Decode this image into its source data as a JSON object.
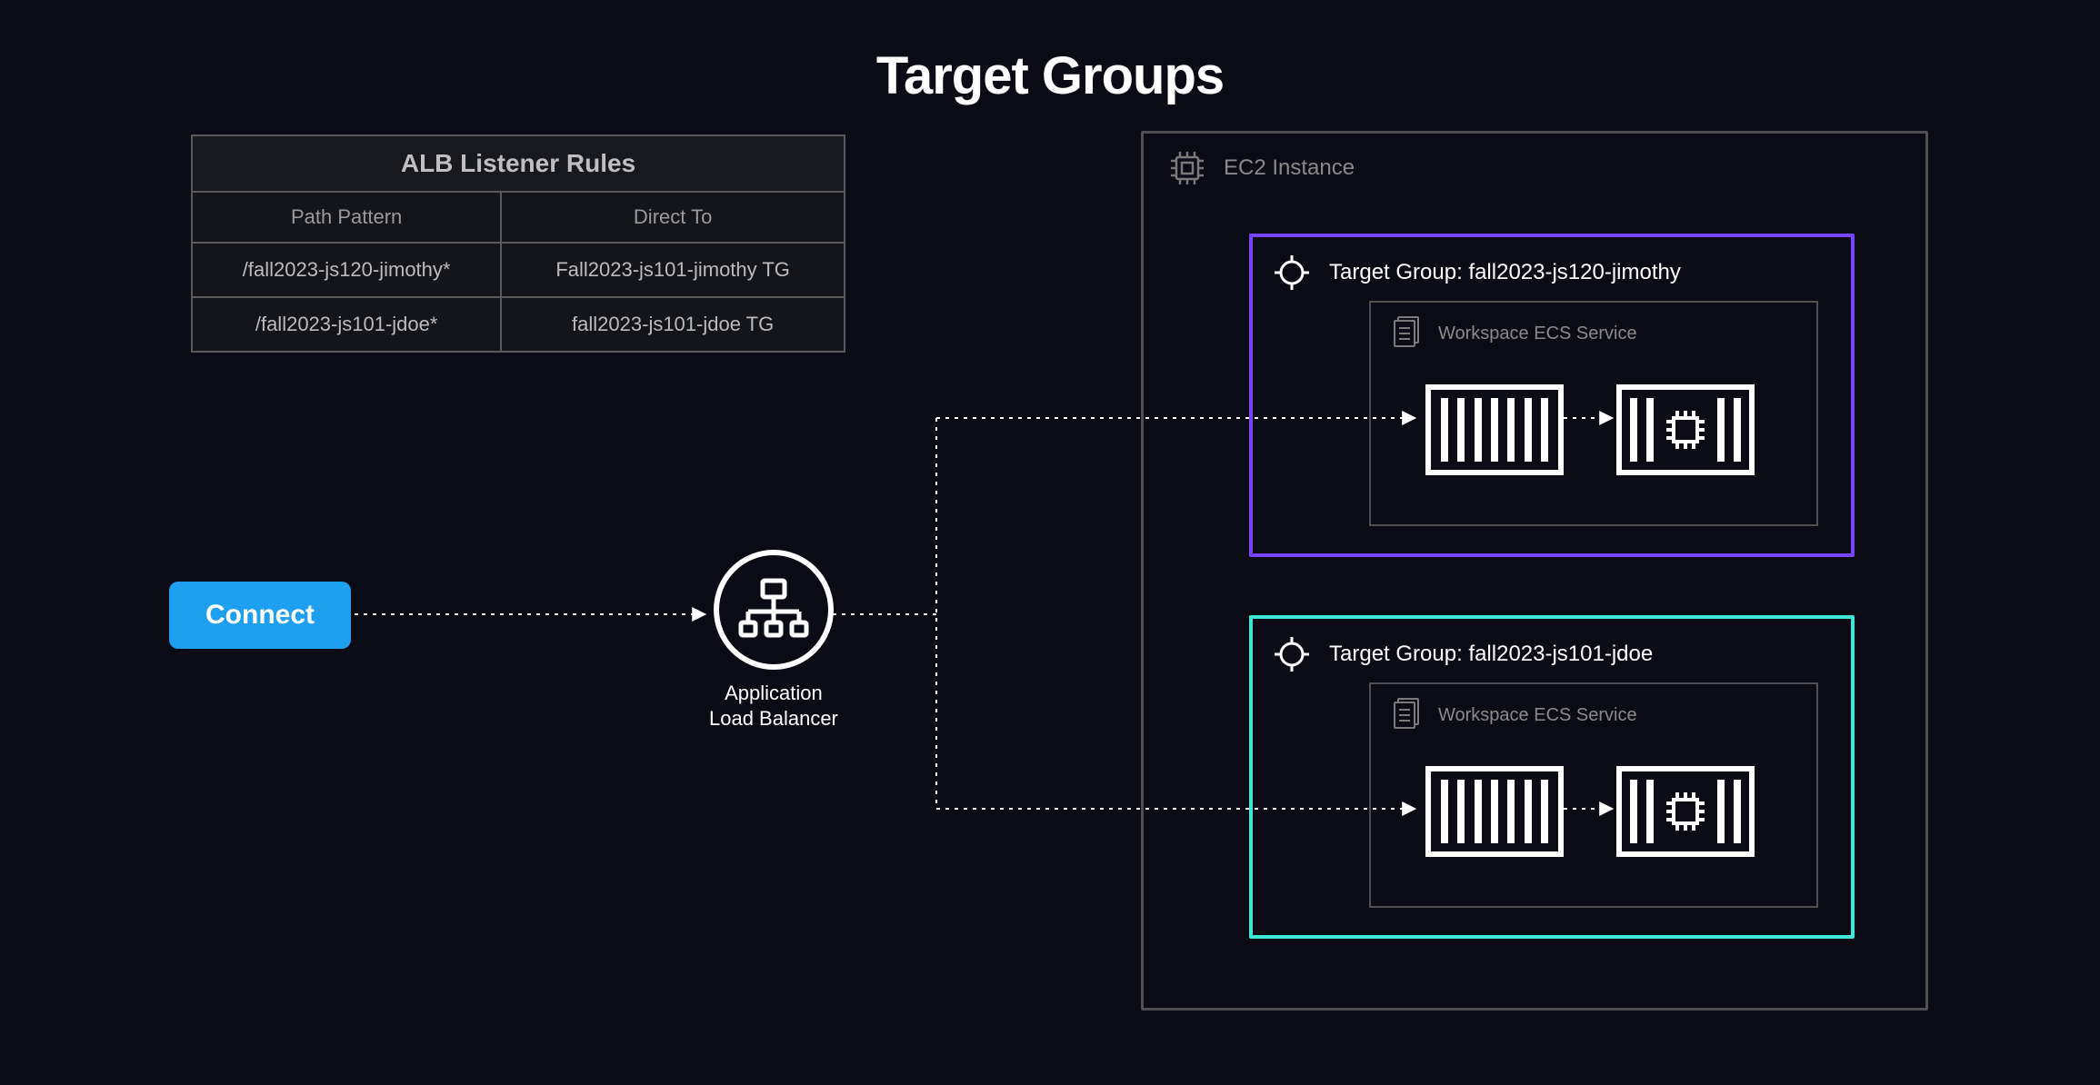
{
  "title": "Target Groups",
  "rules_table": {
    "title": "ALB Listener Rules",
    "columns": [
      "Path Pattern",
      "Direct To"
    ],
    "rows": [
      {
        "pattern": "/fall2023-js120-jimothy*",
        "direct_to": "Fall2023-js101-jimothy TG"
      },
      {
        "pattern": "/fall2023-js101-jdoe*",
        "direct_to": "fall2023-js101-jdoe TG"
      }
    ]
  },
  "connect_button": "Connect",
  "alb": {
    "line1": "Application",
    "line2": "Load Balancer"
  },
  "ec2_label": "EC2 Instance",
  "target_groups": [
    {
      "label": "Target Group: fall2023-js120-jimothy",
      "ecs_label": "Workspace ECS Service",
      "color": "purple"
    },
    {
      "label": "Target Group: fall2023-js101-jdoe",
      "ecs_label": "Workspace ECS Service",
      "color": "teal"
    }
  ]
}
